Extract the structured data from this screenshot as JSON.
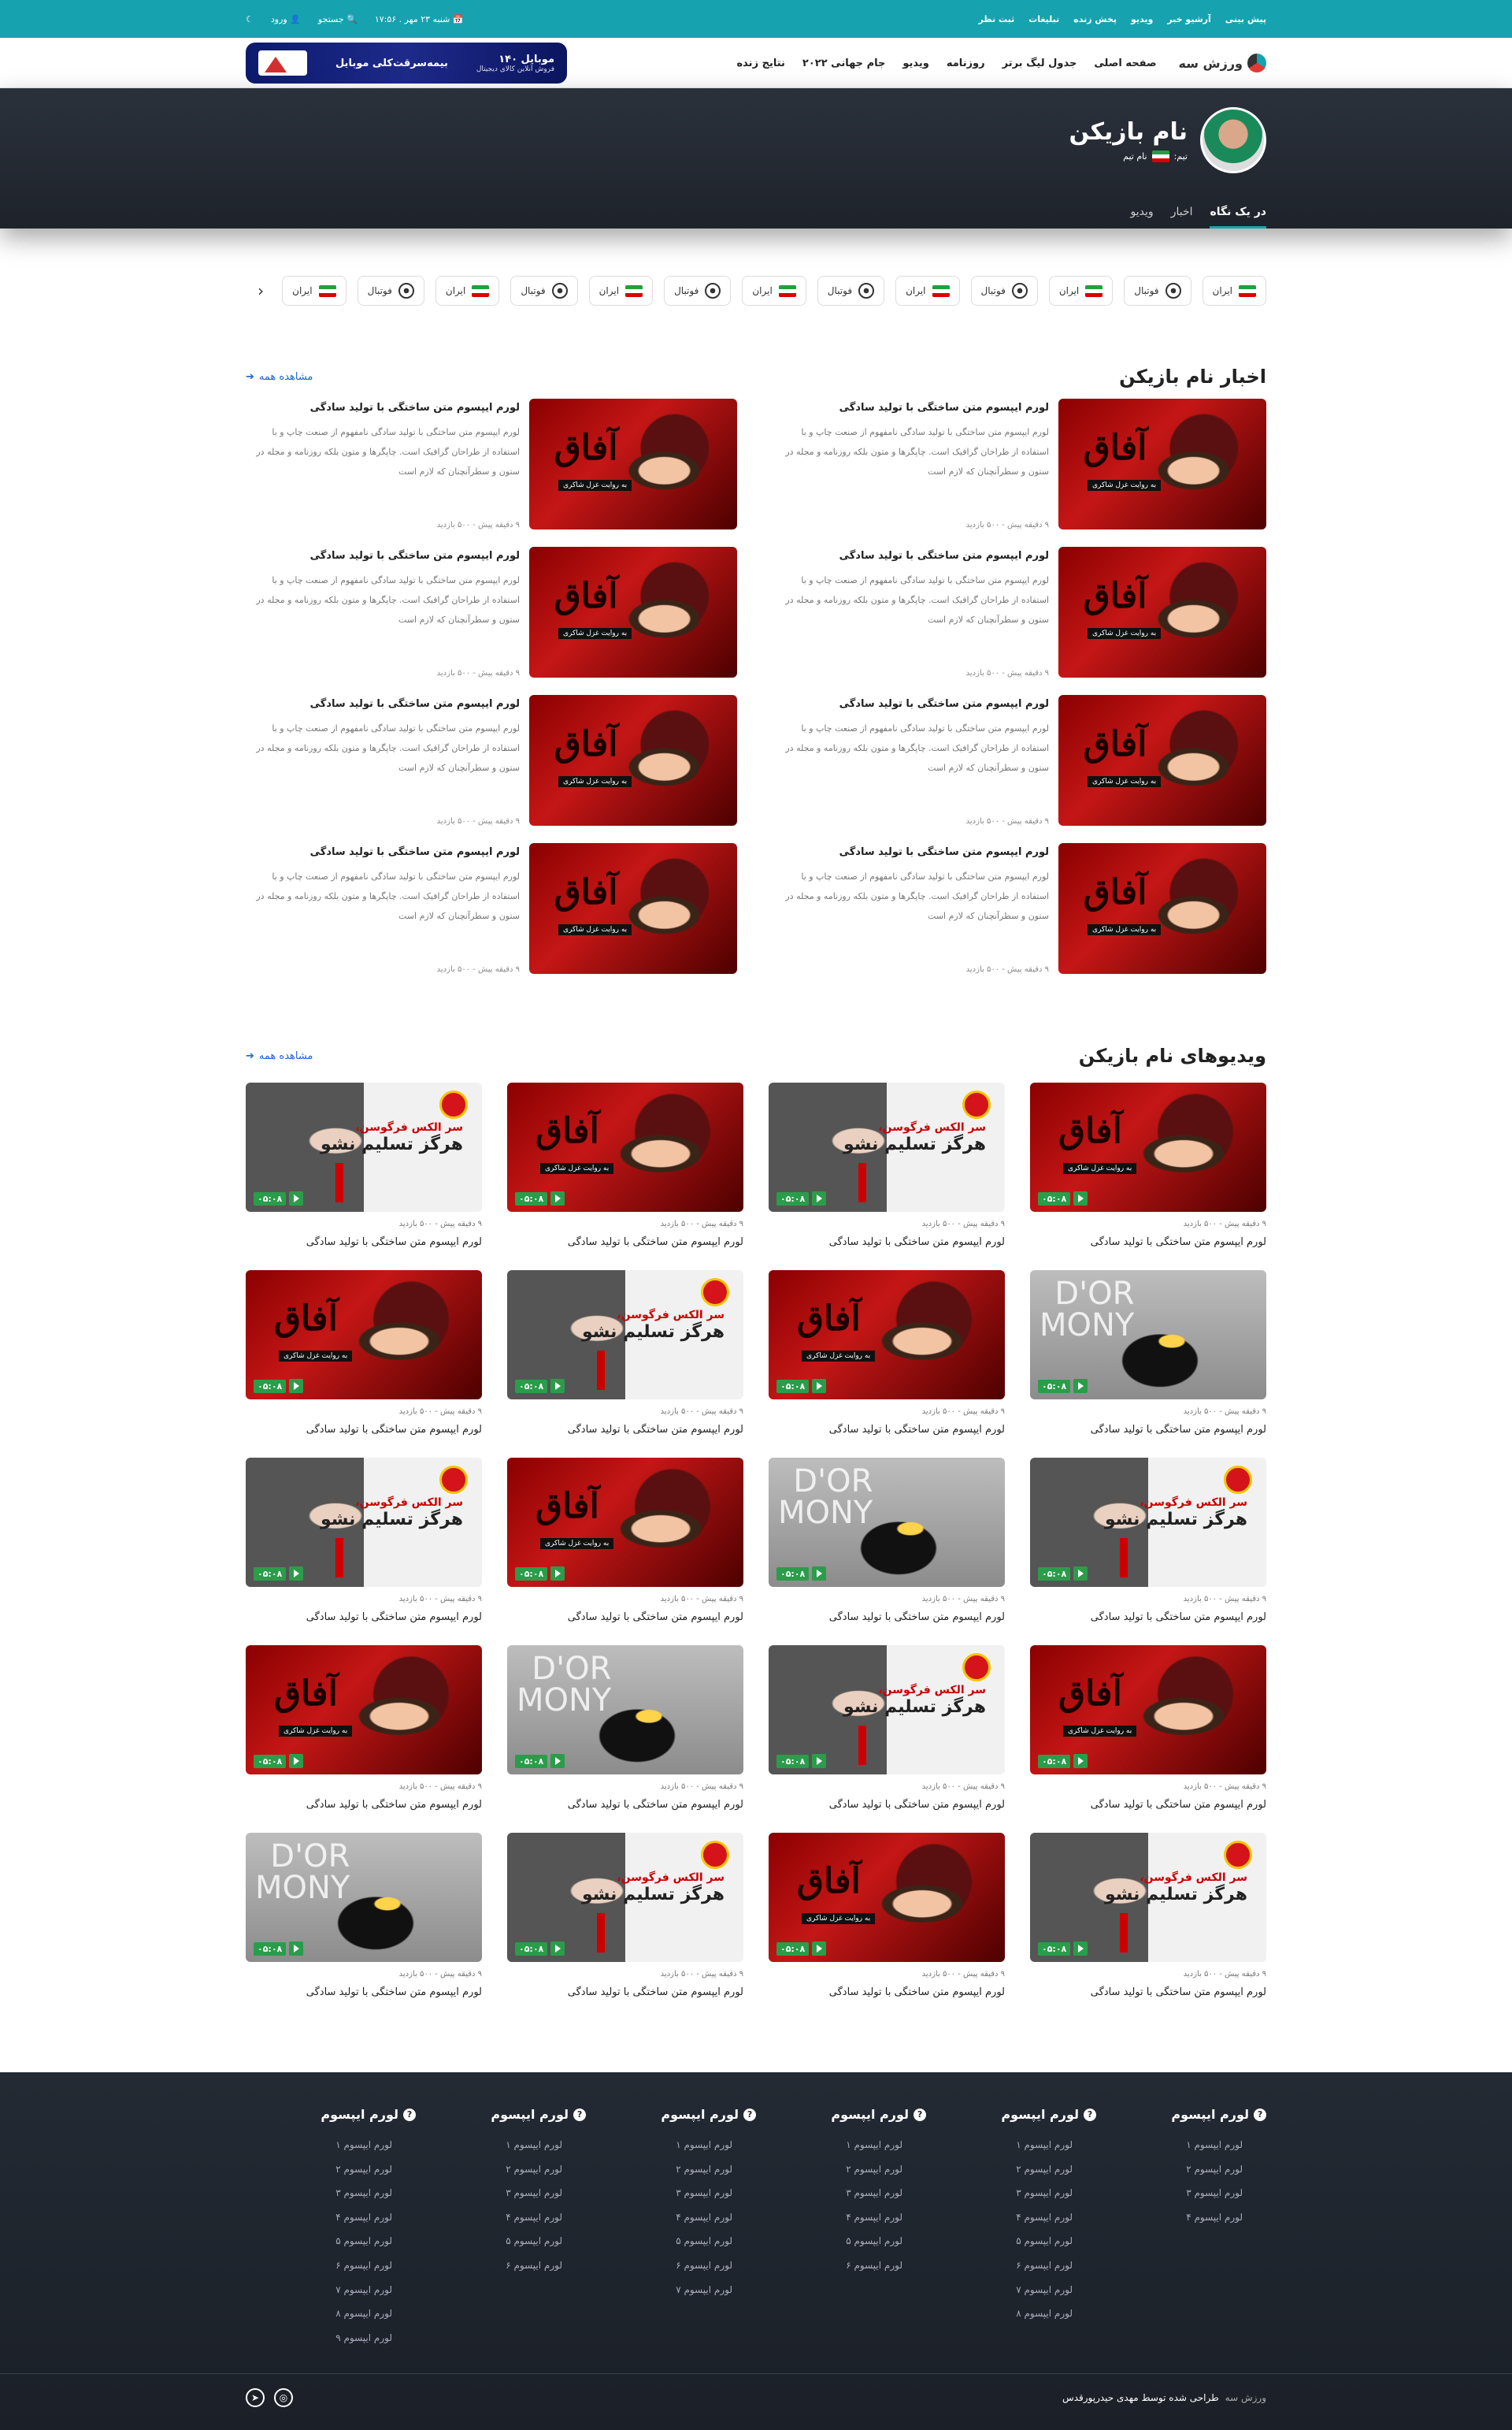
{
  "topbar": {
    "links": [
      "پیش بینی",
      "آرشیو خبر",
      "ویدیو",
      "پخش زنده",
      "تبلیغات",
      "ثبت نظر"
    ],
    "date": "شنبه ۲۳ مهر . ۱۷:۵۶",
    "search": "جستجو",
    "login": "ورود"
  },
  "nav": {
    "brand": "ورزش سه",
    "menu": [
      "صفحه اصلی",
      "جدول لیگ برتر",
      "روزنامه",
      "ویدیو",
      "جام جهانی ۲۰۲۲",
      "نتایج زنده"
    ],
    "banner_title": "بیمه‌سرقت‌کلی موبایل",
    "banner_sub": "فروش آنلاین کالای دیجیتال",
    "banner_logo": "موبایل ۱۴۰"
  },
  "player": {
    "name": "نام بازیکن",
    "team_label": "تیم:",
    "team_name": "نام تیم",
    "tabs": [
      "در یک نگاه",
      "اخبار",
      "ویدیو"
    ]
  },
  "chips": [
    {
      "label": "ایران",
      "icon": "iran-flag-icon"
    },
    {
      "label": "فوتبال",
      "icon": "football-icon"
    },
    {
      "label": "ایران",
      "icon": "iran-flag-icon"
    },
    {
      "label": "فوتبال",
      "icon": "football-icon"
    },
    {
      "label": "ایران",
      "icon": "iran-flag-icon"
    },
    {
      "label": "فوتبال",
      "icon": "football-icon"
    },
    {
      "label": "ایران",
      "icon": "iran-flag-icon"
    },
    {
      "label": "فوتبال",
      "icon": "football-icon"
    },
    {
      "label": "ایران",
      "icon": "iran-flag-icon"
    },
    {
      "label": "فوتبال",
      "icon": "football-icon"
    },
    {
      "label": "ایران",
      "icon": "iran-flag-icon"
    },
    {
      "label": "فوتبال",
      "icon": "football-icon"
    },
    {
      "label": "ایران",
      "icon": "iran-flag-icon"
    }
  ],
  "news": {
    "title": "اخبار نام بازیکن",
    "see_all": "مشاهده همه",
    "item": {
      "title": "لورم ایپسوم متن ساختگی با تولید سادگی",
      "summary": "لورم ایپسوم متن ساختگی با تولید سادگی نامفهوم از صنعت چاپ و با استفاده از طراحان گرافیک است. چاپگرها و متون بلکه روزنامه و مجله در ستون و سطرآنچنان که لازم است",
      "meta": "۹ دقیقه پیش - ۵۰۰ بازدید",
      "thumb_big": "آفاق",
      "thumb_cap": "به روایت غزل شاکری"
    },
    "count": 8
  },
  "videos": {
    "title": "ویدیوهای نام بازیکن",
    "see_all": "مشاهده همه",
    "duration": "۰۵:۰۸",
    "meta": "۹ دقیقه پیش - ۵۰۰ بازدید",
    "item_title": "لورم ایپسوم متن ساختگی با تولید سادگی",
    "fergie_top": "سر الکس فرگوسن،",
    "fergie_main": "هرگز تسلیم نشو",
    "benz_text": "D'OR\nMONY",
    "thumbs": [
      "klopp",
      "fergie",
      "klopp",
      "fergie",
      "benz",
      "klopp",
      "fergie",
      "klopp",
      "fergie",
      "benz",
      "klopp",
      "fergie",
      "klopp",
      "fergie",
      "benz",
      "klopp",
      "fergie",
      "klopp",
      "fergie",
      "benz"
    ]
  },
  "footer": {
    "columns": [
      {
        "title": "لورم ایپسوم",
        "items": [
          "لورم ایپسوم ۱",
          "لورم ایپسوم ۲",
          "لورم ایپسوم ۳",
          "لورم ایپسوم ۴"
        ]
      },
      {
        "title": "لورم ایپسوم",
        "items": [
          "لورم ایپسوم ۱",
          "لورم ایپسوم ۲",
          "لورم ایپسوم ۳",
          "لورم ایپسوم ۴",
          "لورم ایپسوم ۵",
          "لورم ایپسوم ۶",
          "لورم ایپسوم ۷",
          "لورم ایپسوم ۸"
        ]
      },
      {
        "title": "لورم ایپسوم",
        "items": [
          "لورم ایپسوم ۱",
          "لورم ایپسوم ۲",
          "لورم ایپسوم ۳",
          "لورم ایپسوم ۴",
          "لورم ایپسوم ۵",
          "لورم ایپسوم ۶"
        ]
      },
      {
        "title": "لورم ایپسوم",
        "items": [
          "لورم ایپسوم ۱",
          "لورم ایپسوم ۲",
          "لورم ایپسوم ۳",
          "لورم ایپسوم ۴",
          "لورم ایپسوم ۵",
          "لورم ایپسوم ۶",
          "لورم ایپسوم ۷"
        ]
      },
      {
        "title": "لورم ایپسوم",
        "items": [
          "لورم ایپسوم ۱",
          "لورم ایپسوم ۲",
          "لورم ایپسوم ۳",
          "لورم ایپسوم ۴",
          "لورم ایپسوم ۵",
          "لورم ایپسوم ۶"
        ]
      },
      {
        "title": "لورم ایپسوم",
        "items": [
          "لورم ایپسوم ۱",
          "لورم ایپسوم ۲",
          "لورم ایپسوم ۳",
          "لورم ایپسوم ۴",
          "لورم ایپسوم ۵",
          "لورم ایپسوم ۶",
          "لورم ایپسوم ۷",
          "لورم ایپسوم ۸",
          "لورم ایپسوم ۹"
        ]
      }
    ],
    "brand": "ورزش سه",
    "credit": "طراحی شده توسط مهدی حیدرپورقدس"
  },
  "colors": {
    "accent": "#17a2b0",
    "link": "#1e63d6",
    "dark": "#1e232b",
    "green": "#2a9d4a"
  }
}
